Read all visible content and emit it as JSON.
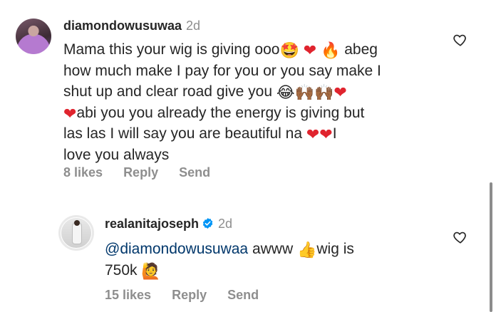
{
  "comments": [
    {
      "username": "diamondowusuwaa",
      "time": "2d",
      "text_lines": [
        "Mama this your wig is giving ooo",
        "abeg",
        "how much make I pay for you or you say make I",
        "shut up and clear road give you",
        "abi you you already the energy is giving but",
        "las las I will say you are beautiful na",
        "I",
        "love you always"
      ],
      "likes": "8 likes",
      "reply_label": "Reply",
      "send_label": "Send"
    },
    {
      "username": "realanitajoseph",
      "verified": true,
      "time": "2d",
      "mention": "@diamondowusuwaa",
      "text_part1": "awww",
      "text_part2": "wig is",
      "text_part3": "750k",
      "likes": "15 likes",
      "reply_label": "Reply",
      "send_label": "Send"
    }
  ],
  "icons": {
    "star_struck": "🤩",
    "heart": "❤",
    "fire": "🔥",
    "laughing": "😂",
    "raised_hands": "🙌🏾",
    "thumbs_up": "👍",
    "person_raising_hand": "🙋"
  },
  "colors": {
    "text": "#262626",
    "secondary": "#8e8e8e",
    "mention": "#00376b",
    "verified": "#0095f6",
    "heart": "#e0242e"
  }
}
